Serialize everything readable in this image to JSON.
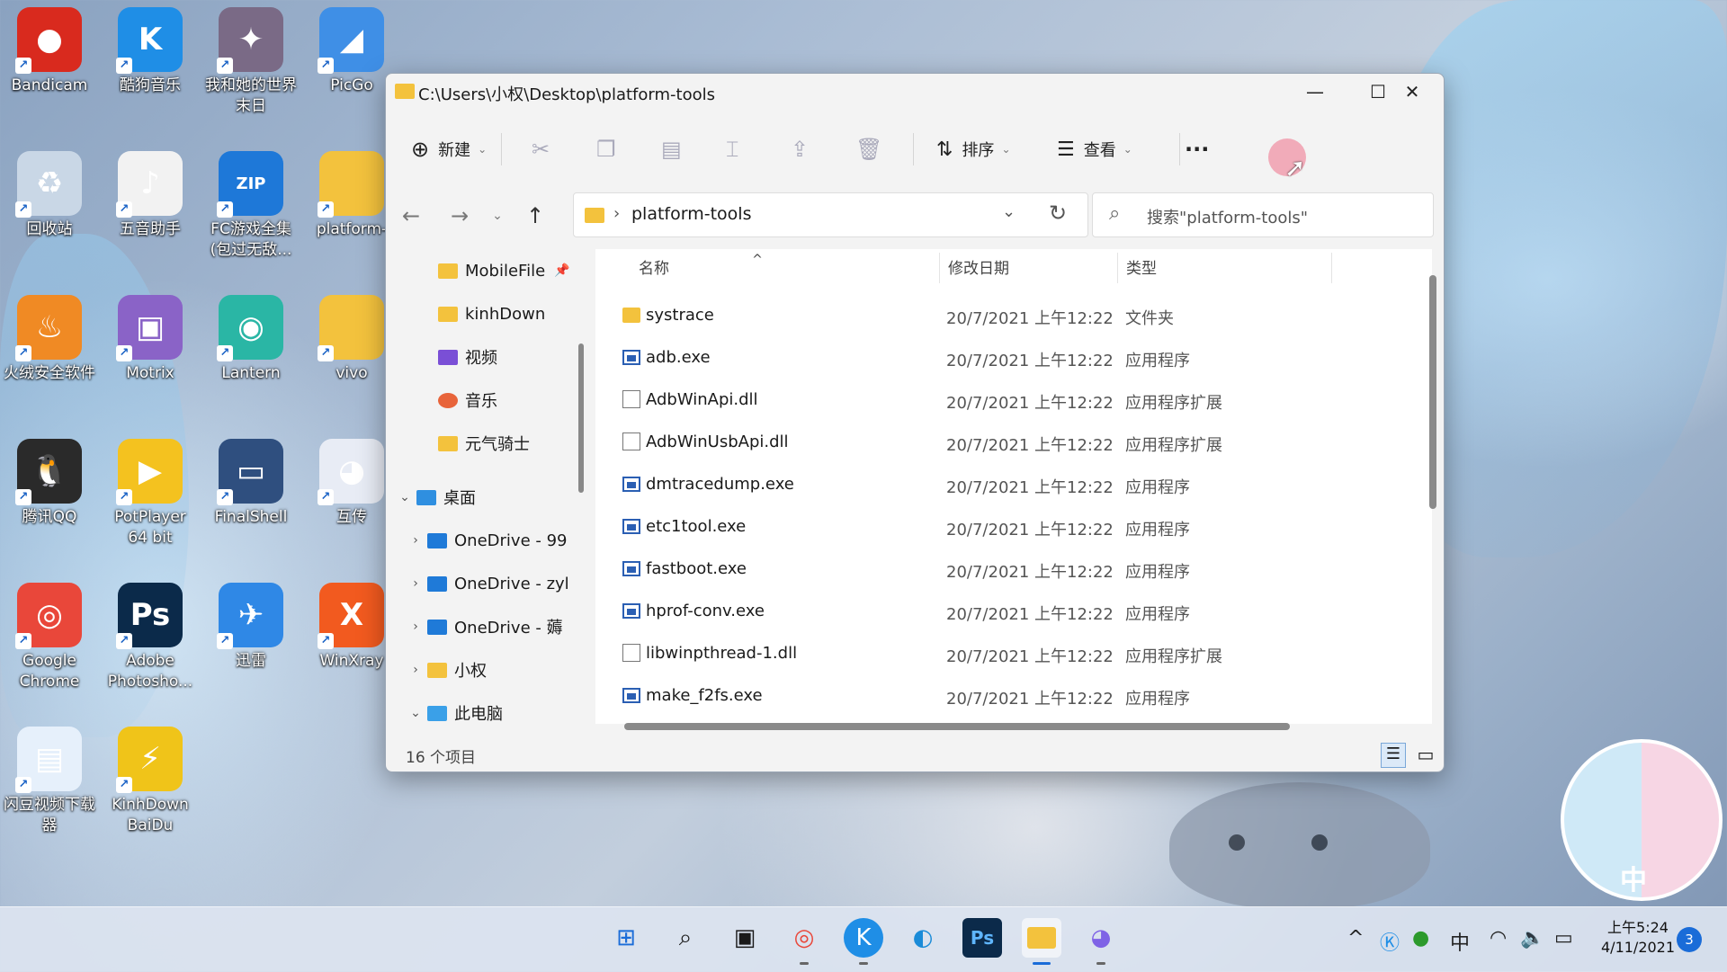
{
  "desktop": {
    "icons": [
      {
        "label": "Bandicam",
        "color": "#d92a1e",
        "glyph": "●"
      },
      {
        "label": "酷狗音乐",
        "color": "#1f8ee6",
        "glyph": "K"
      },
      {
        "label": "我和她的世界\n末日",
        "color": "#7a6a86",
        "glyph": "✦"
      },
      {
        "label": "PicGo",
        "color": "#3f8fe6",
        "glyph": "◢"
      },
      {
        "label": "回收站",
        "color": "#c9d7e6",
        "glyph": "♻"
      },
      {
        "label": "五音助手",
        "color": "#f2f2f2",
        "glyph": "♪"
      },
      {
        "label": "FC游戏全集\n(包过无敌...",
        "color": "#1e78d8",
        "glyph": "ZIP"
      },
      {
        "label": "platform-",
        "color": "#f3c23d",
        "glyph": ""
      },
      {
        "label": "火绒安全软件",
        "color": "#f08a24",
        "glyph": "♨"
      },
      {
        "label": "Motrix",
        "color": "#8a63c7",
        "glyph": "▣"
      },
      {
        "label": "Lantern",
        "color": "#2ab6a5",
        "glyph": "◉"
      },
      {
        "label": "vivo",
        "color": "#f3c23d",
        "glyph": ""
      },
      {
        "label": "腾讯QQ",
        "color": "#2a2a2a",
        "glyph": "🐧"
      },
      {
        "label": "PotPlayer\n64 bit",
        "color": "#f4c21f",
        "glyph": "▶"
      },
      {
        "label": "FinalShell",
        "color": "#2f4f7f",
        "glyph": "▭"
      },
      {
        "label": "互传",
        "color": "#e8ecf5",
        "glyph": "◕"
      },
      {
        "label": "Google\nChrome",
        "color": "#e9473a",
        "glyph": "◎"
      },
      {
        "label": "Adobe\nPhotosho...",
        "color": "#0b2a4a",
        "glyph": "Ps"
      },
      {
        "label": "迅雷",
        "color": "#2f88e6",
        "glyph": "✈"
      },
      {
        "label": "WinXray",
        "color": "#f25a1f",
        "glyph": "X"
      },
      {
        "label": "闪豆视频下载\n器",
        "color": "#e6f0fb",
        "glyph": "▤"
      },
      {
        "label": "KinhDown\nBaiDu",
        "color": "#f0c419",
        "glyph": "⚡"
      }
    ]
  },
  "window": {
    "title": "C:\\Users\\小权\\Desktop\\platform-tools",
    "controls": {
      "minimize": "—",
      "maximize": "☐",
      "close": "✕"
    },
    "toolbar": {
      "new_label": "新建",
      "sort_label": "排序",
      "view_label": "查看",
      "more_label": "···"
    },
    "address": {
      "path": "platform-tools",
      "search_placeholder": "搜索\"platform-tools\""
    },
    "nav": [
      {
        "label": "MobileFile",
        "icon": "folder-icon",
        "pinned": true
      },
      {
        "label": "kinhDown",
        "icon": "folder-icon"
      },
      {
        "label": "视频",
        "icon": "video-icon"
      },
      {
        "label": "音乐",
        "icon": "music-icon"
      },
      {
        "label": "元气骑士",
        "icon": "folder-icon"
      },
      {
        "label": "桌面",
        "icon": "desktop-icon"
      },
      {
        "label": "OneDrive - 99",
        "icon": "cloud-icon"
      },
      {
        "label": "OneDrive - zyl",
        "icon": "cloud-icon"
      },
      {
        "label": "OneDrive - 薅",
        "icon": "cloud-icon"
      },
      {
        "label": "小权",
        "icon": "folder-icon"
      },
      {
        "label": "此电脑",
        "icon": "pc-icon"
      }
    ],
    "columns": {
      "name": "名称",
      "date": "修改日期",
      "type": "类型"
    },
    "files": [
      {
        "name": "systrace",
        "date": "20/7/2021 上午12:22",
        "type": "文件夹",
        "kind": "folder"
      },
      {
        "name": "adb.exe",
        "date": "20/7/2021 上午12:22",
        "type": "应用程序",
        "kind": "exe"
      },
      {
        "name": "AdbWinApi.dll",
        "date": "20/7/2021 上午12:22",
        "type": "应用程序扩展",
        "kind": "dll"
      },
      {
        "name": "AdbWinUsbApi.dll",
        "date": "20/7/2021 上午12:22",
        "type": "应用程序扩展",
        "kind": "dll"
      },
      {
        "name": "dmtracedump.exe",
        "date": "20/7/2021 上午12:22",
        "type": "应用程序",
        "kind": "exe"
      },
      {
        "name": "etc1tool.exe",
        "date": "20/7/2021 上午12:22",
        "type": "应用程序",
        "kind": "exe"
      },
      {
        "name": "fastboot.exe",
        "date": "20/7/2021 上午12:22",
        "type": "应用程序",
        "kind": "exe"
      },
      {
        "name": "hprof-conv.exe",
        "date": "20/7/2021 上午12:22",
        "type": "应用程序",
        "kind": "exe"
      },
      {
        "name": "libwinpthread-1.dll",
        "date": "20/7/2021 上午12:22",
        "type": "应用程序扩展",
        "kind": "dll"
      },
      {
        "name": "make_f2fs.exe",
        "date": "20/7/2021 上午12:22",
        "type": "应用程序",
        "kind": "exe"
      }
    ],
    "status": "16 个项目"
  },
  "taskbar": {
    "clock_time": "上午5:24",
    "clock_date": "4/11/2021",
    "notification_count": "3",
    "ime": "中"
  },
  "sticker_text": "中"
}
